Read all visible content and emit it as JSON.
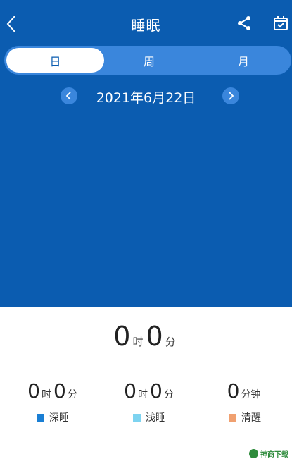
{
  "header": {
    "title": "睡眠",
    "back_icon": "chevron-left-icon",
    "share_icon": "share-icon",
    "calendar_icon": "calendar-check-icon"
  },
  "tabs": [
    {
      "label": "日",
      "active": true
    },
    {
      "label": "周",
      "active": false
    },
    {
      "label": "月",
      "active": false
    }
  ],
  "date_nav": {
    "date": "2021年6月22日",
    "prev_icon": "chevron-left-icon",
    "next_icon": "chevron-right-icon"
  },
  "total": {
    "hours": "0",
    "hours_unit": "时",
    "minutes": "0",
    "minutes_unit": "分"
  },
  "stats": {
    "deep": {
      "hours": "0",
      "hours_unit": "时",
      "minutes": "0",
      "minutes_unit": "分",
      "label": "深睡",
      "color": "#1a7fd4"
    },
    "light": {
      "hours": "0",
      "hours_unit": "时",
      "minutes": "0",
      "minutes_unit": "分",
      "label": "浅睡",
      "color": "#7dd3f0"
    },
    "awake": {
      "minutes": "0",
      "minutes_unit": "分钟",
      "label": "清醒",
      "color": "#f0a070"
    }
  },
  "watermark": {
    "text": "神商下载"
  },
  "colors": {
    "primary": "#0b5cb0",
    "tab_track": "#3a86dc",
    "white": "#ffffff"
  }
}
